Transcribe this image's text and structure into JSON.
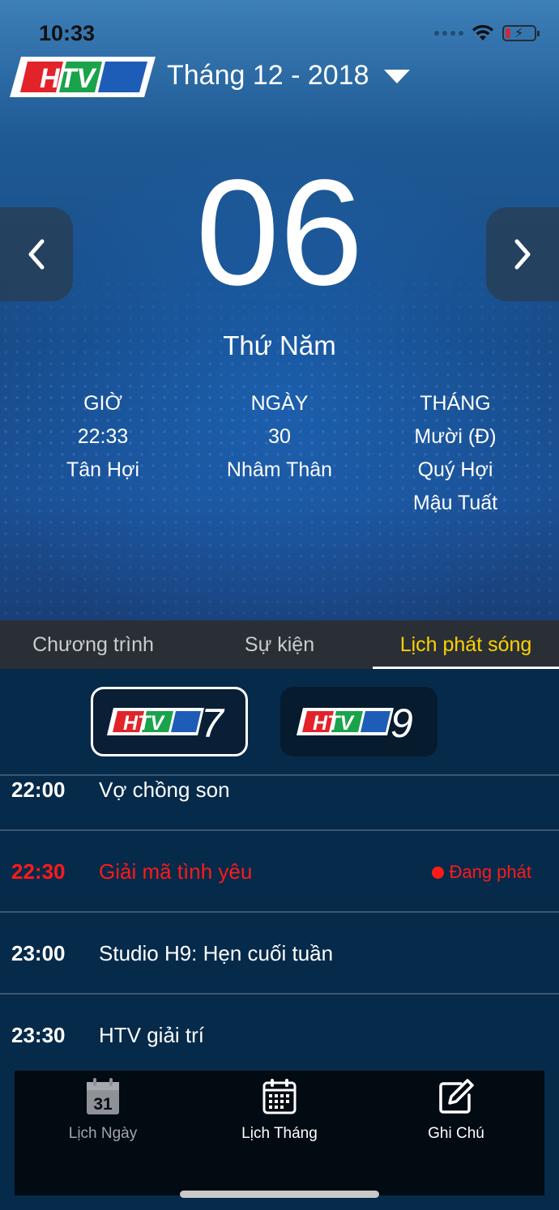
{
  "status": {
    "time": "10:33"
  },
  "header": {
    "logo_text": "HTV",
    "month_title": "Tháng 12 - 2018"
  },
  "day": {
    "number": "06",
    "weekday": "Thứ Năm"
  },
  "lunar": {
    "hour": {
      "label": "GIỜ",
      "value": "22:33",
      "name": "Tân Hợi"
    },
    "day": {
      "label": "NGÀY",
      "value": "30",
      "name": "Nhâm Thân"
    },
    "month": {
      "label": "THÁNG",
      "value": "Mười (Đ)",
      "name": "Quý Hợi",
      "year": "Mậu Tuất"
    }
  },
  "tabs": [
    {
      "label": "Chương trình"
    },
    {
      "label": "Sự kiện"
    },
    {
      "label": "Lịch phát sóng"
    }
  ],
  "channels": [
    {
      "logo_text": "HTV",
      "number": "7",
      "selected": true
    },
    {
      "logo_text": "HTV",
      "number": "9",
      "selected": false
    }
  ],
  "schedule": [
    {
      "time": "22:00",
      "title": "Vợ chồng son"
    },
    {
      "time": "22:30",
      "title": "Giải mã tình yêu",
      "badge": "Đang phát"
    },
    {
      "time": "23:00",
      "title": "Studio H9: Hẹn cuối tuần"
    },
    {
      "time": "23:30",
      "title": "HTV giải trí"
    }
  ],
  "bottom_nav": [
    {
      "label": "Lịch Ngày",
      "icon": "calendar-day-icon",
      "icon_text": "31"
    },
    {
      "label": "Lịch Tháng",
      "icon": "calendar-month-icon"
    },
    {
      "label": "Ghi Chú",
      "icon": "note-edit-icon"
    }
  ],
  "colors": {
    "live_red": "#ff1a1a",
    "active_tab": "#ffd200",
    "tab_bar": "#2a2f36",
    "schedule_bg": "#062a4a"
  }
}
